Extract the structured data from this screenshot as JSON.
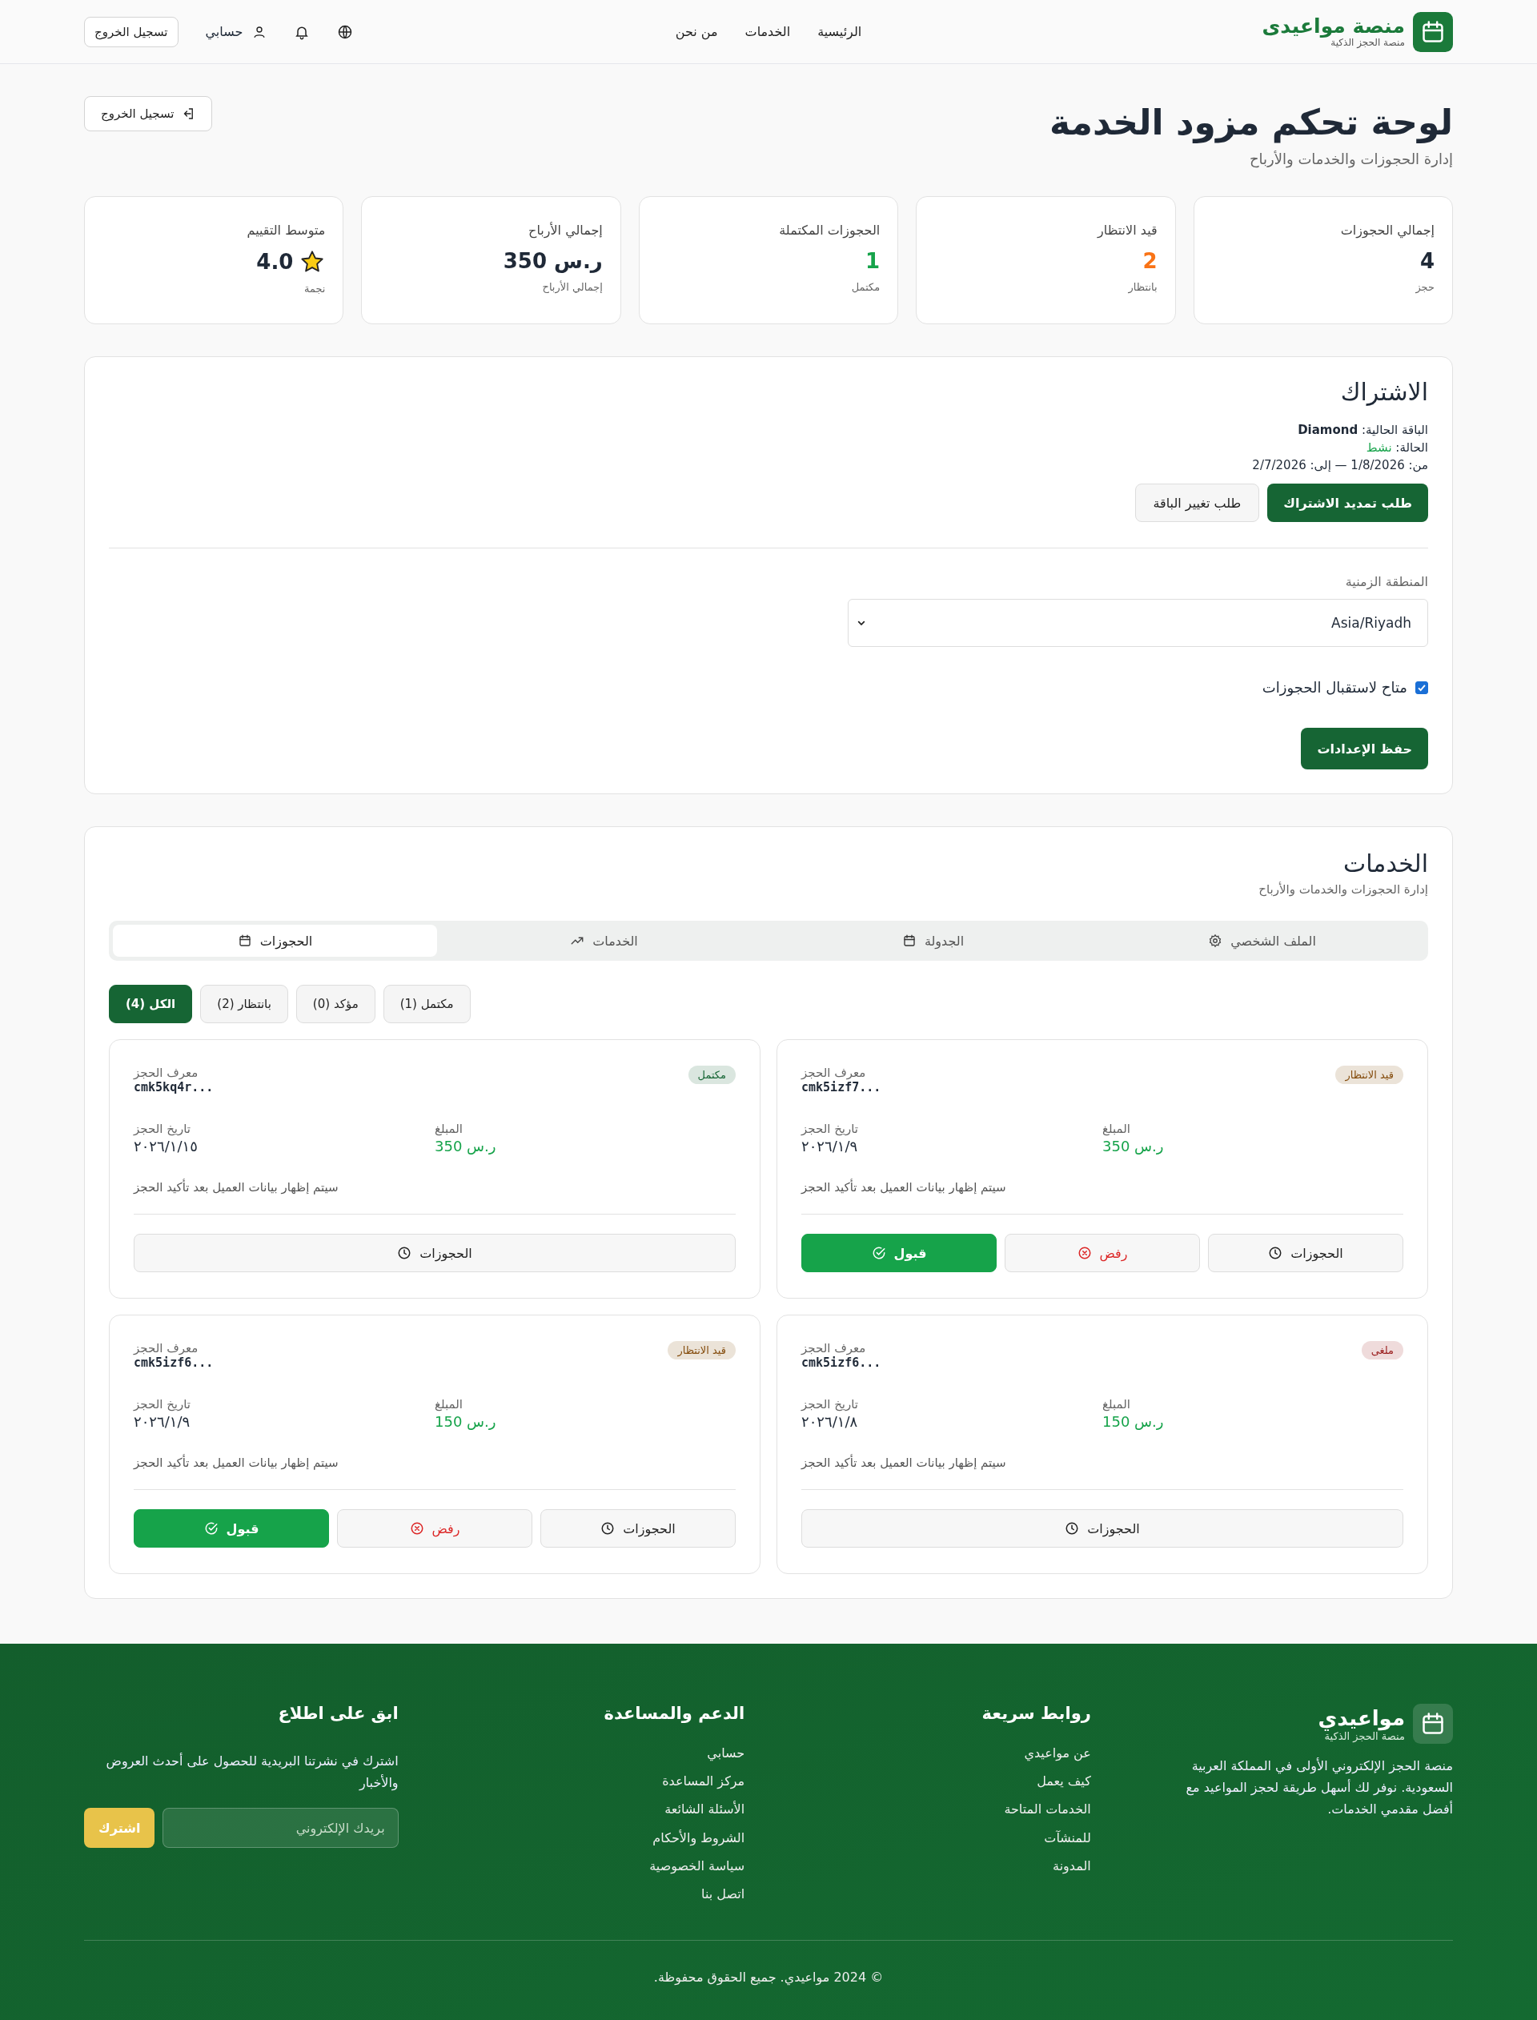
{
  "header": {
    "brand": {
      "name": "منصة مواعيدى",
      "tagline": "منصة الحجز الذكية"
    },
    "nav": [
      "الرئيسية",
      "الخدمات",
      "من نحن"
    ],
    "account": "حسابي",
    "logout": "تسجيل الخروج"
  },
  "page": {
    "title": "لوحة تحكم مزود الخدمة",
    "subtitle": "إدارة الحجوزات والخدمات والأرباح",
    "logout": "تسجيل الخروج"
  },
  "stats": [
    {
      "kind": "plain",
      "label": "إجمالي الحجوزات",
      "value": "4",
      "caption": "حجز",
      "color": "#1f2937"
    },
    {
      "kind": "plain",
      "label": "قيد الانتظار",
      "value": "2",
      "caption": "بانتظار",
      "color": "#f97316"
    },
    {
      "kind": "plain",
      "label": "الحجوزات المكتملة",
      "value": "1",
      "caption": "مكتمل",
      "color": "#16a34a"
    },
    {
      "kind": "plain",
      "label": "إجمالي الأرباح",
      "value": "ر.س 350",
      "caption": "إجمالي الأرباح",
      "color": "#1f2937"
    },
    {
      "kind": "rating",
      "label": "متوسط التقييم",
      "value": "4.0",
      "caption": "نجمة",
      "color": "#1f2937"
    }
  ],
  "subscription": {
    "title": "الاشتراك",
    "plan_label": "الباقة الحالية:",
    "plan": "Diamond",
    "status_label": "الحالة:",
    "status": "نشط",
    "period": "من: 1/8/2026 — إلى: 2/7/2026",
    "buttons": [
      {
        "label": "طلب تمديد الاشتراك",
        "kind": "primary"
      },
      {
        "label": "طلب تغيير الباقة",
        "kind": "secondary"
      }
    ],
    "timezone": {
      "label": "المنطقة الزمنية",
      "value": "Asia/Riyadh"
    },
    "available": {
      "label": "متاح لاستقبال الحجوزات",
      "checked": true
    },
    "save": "حفظ الإعدادات"
  },
  "services": {
    "title": "الخدمات",
    "subtitle": "إدارة الحجوزات والخدمات والأرباح",
    "tabs": [
      {
        "label": "الملف الشخصي",
        "selected": false
      },
      {
        "label": "الجدولة",
        "selected": false
      },
      {
        "label": "الخدمات",
        "selected": false
      },
      {
        "label": "الحجوزات",
        "selected": true
      }
    ],
    "filters": [
      {
        "label": "مكتمل (1)",
        "selected": false
      },
      {
        "label": "مؤكد (0)",
        "selected": false
      },
      {
        "label": "بانتظار (2)",
        "selected": false
      },
      {
        "label": "الكل (4)",
        "selected": true
      }
    ],
    "bookings": [
      {
        "color": "#854d0e",
        "status_label": "قيد الانتظار",
        "id_label": "معرف الحجز",
        "id": "cmk5izf7...",
        "amount_label": "المبلغ",
        "amount": "ر.س 350",
        "date_label": "تاريخ الحجز",
        "date": "٢٠٢٦/١/٩",
        "note": "سيتم إظهار بيانات العميل بعد تأكيد الحجز",
        "actions": [
          {
            "kind": "details",
            "label": "الحجوزات"
          },
          {
            "kind": "reject",
            "label": "رفض"
          },
          {
            "kind": "accept",
            "label": "قبول"
          }
        ]
      },
      {
        "color": "#166534",
        "status_label": "مكتمل",
        "id_label": "معرف الحجز",
        "id": "cmk5kq4r...",
        "amount_label": "المبلغ",
        "amount": "ر.س 350",
        "date_label": "تاريخ الحجز",
        "date": "٢٠٢٦/١/١٥",
        "note": "سيتم إظهار بيانات العميل بعد تأكيد الحجز",
        "actions": [
          {
            "kind": "details",
            "label": "الحجوزات"
          }
        ]
      },
      {
        "color": "#991b1b",
        "status_label": "ملغى",
        "id_label": "معرف الحجز",
        "id": "cmk5izf6...",
        "amount_label": "المبلغ",
        "amount": "ر.س 150",
        "date_label": "تاريخ الحجز",
        "date": "٢٠٢٦/١/٨",
        "note": "سيتم إظهار بيانات العميل بعد تأكيد الحجز",
        "actions": [
          {
            "kind": "details",
            "label": "الحجوزات"
          }
        ]
      },
      {
        "color": "#854d0e",
        "status_label": "قيد الانتظار",
        "id_label": "معرف الحجز",
        "id": "cmk5izf6...",
        "amount_label": "المبلغ",
        "amount": "ر.س 150",
        "date_label": "تاريخ الحجز",
        "date": "٢٠٢٦/١/٩",
        "note": "سيتم إظهار بيانات العميل بعد تأكيد الحجز",
        "actions": [
          {
            "kind": "details",
            "label": "الحجوزات"
          },
          {
            "kind": "reject",
            "label": "رفض"
          },
          {
            "kind": "accept",
            "label": "قبول"
          }
        ]
      }
    ]
  },
  "footer": {
    "brand": {
      "name": "مواعيدي",
      "tagline": "منصة الحجز الذكية",
      "description": "منصة الحجز الإلكتروني الأولى في المملكة العربية السعودية. نوفر لك أسهل طريقة لحجز المواعيد مع أفضل مقدمي الخدمات."
    },
    "columns": [
      {
        "title": "روابط سريعة",
        "links": [
          "عن مواعيدي",
          "كيف يعمل",
          "الخدمات المتاحة",
          "للمنشآت",
          "المدونة"
        ]
      },
      {
        "title": "الدعم والمساعدة",
        "links": [
          "حسابي",
          "مركز المساعدة",
          "الأسئلة الشائعة",
          "الشروط والأحكام",
          "سياسة الخصوصية",
          "اتصل بنا"
        ]
      }
    ],
    "newsletter": {
      "title": "ابق على اطلاع",
      "text": "اشترك في نشرتنا البريدية للحصول على أحدث العروض والأخبار",
      "placeholder": "بريدك الإلكتروني",
      "button": "اشترك"
    },
    "copyright": "© 2024 مواعيدي. جميع الحقوق محفوظة."
  }
}
